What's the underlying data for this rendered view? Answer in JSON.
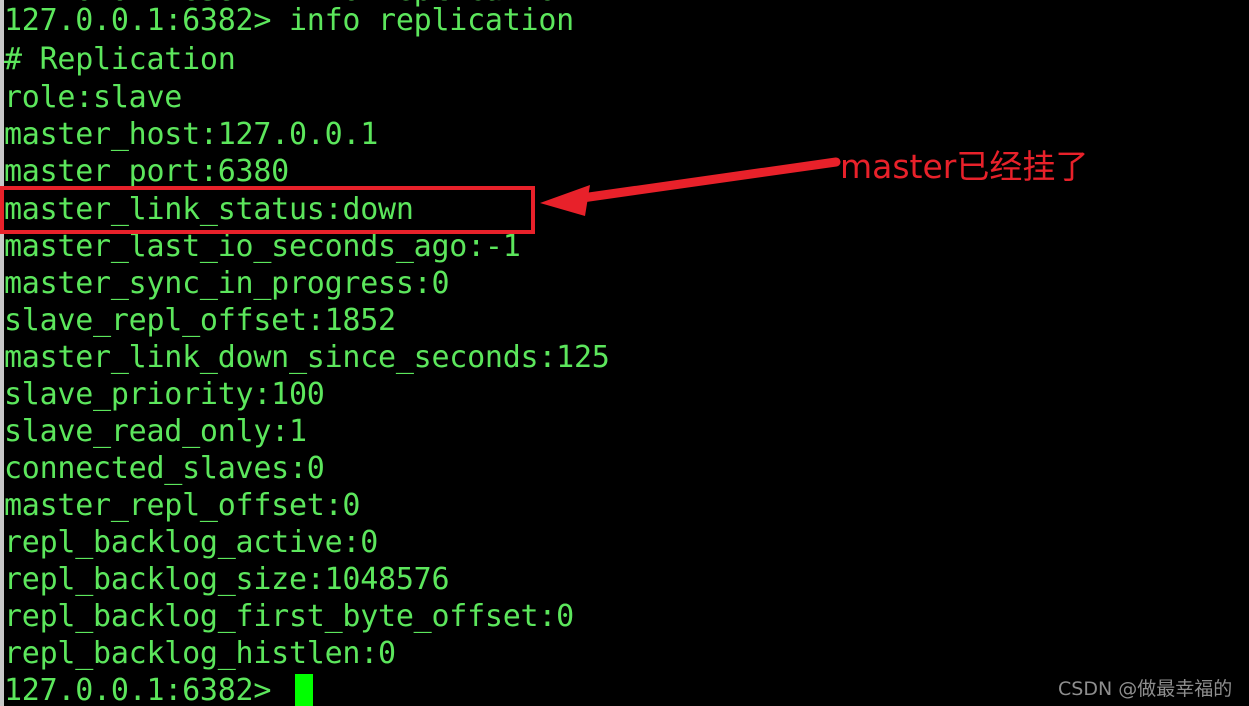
{
  "terminal": {
    "background_color": "#000000",
    "text_color": "#5ce65c",
    "cursor_color": "#00ff00",
    "clipped_top_line": "127.0.0.1:6382> info replication",
    "lines": [
      "127.0.0.1:6382> info replication",
      "# Replication",
      "role:slave",
      "master_host:127.0.0.1",
      "master_port:6380",
      "master_link_status:down",
      "master_last_io_seconds_ago:-1",
      "master_sync_in_progress:0",
      "slave_repl_offset:1852",
      "master_link_down_since_seconds:125",
      "slave_priority:100",
      "slave_read_only:1",
      "connected_slaves:0",
      "master_repl_offset:0",
      "repl_backlog_active:0",
      "repl_backlog_size:1048576",
      "repl_backlog_first_byte_offset:0",
      "repl_backlog_histlen:0",
      "127.0.0.1:6382> "
    ],
    "prompt": "127.0.0.1:6382> ",
    "command": "info replication",
    "section_header": "# Replication",
    "replication_info": {
      "role": "slave",
      "master_host": "127.0.0.1",
      "master_port": "6380",
      "master_link_status": "down",
      "master_last_io_seconds_ago": "-1",
      "master_sync_in_progress": "0",
      "slave_repl_offset": "1852",
      "master_link_down_since_seconds": "125",
      "slave_priority": "100",
      "slave_read_only": "1",
      "connected_slaves": "0",
      "master_repl_offset": "0",
      "repl_backlog_active": "0",
      "repl_backlog_size": "1048576",
      "repl_backlog_first_byte_offset": "0",
      "repl_backlog_histlen": "0"
    }
  },
  "annotation": {
    "color": "#e8212a",
    "label": "master已经挂了",
    "highlighted_line": "master_link_status:down",
    "arrow": "left-pointing-arrow"
  },
  "watermark": {
    "text": "CSDN @做最幸福的",
    "color": "#8e8e8e"
  }
}
